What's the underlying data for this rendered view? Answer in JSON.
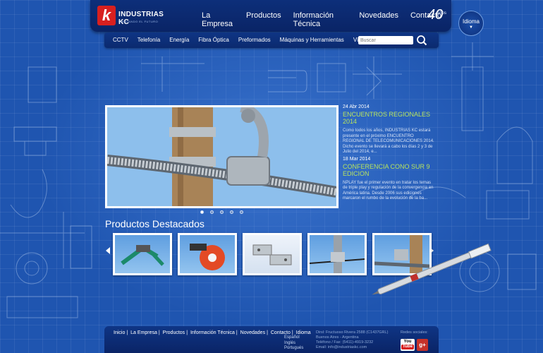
{
  "brand": {
    "mark": "k",
    "name": "INDUSTRIAS KC",
    "tagline": "DIBUJANDO EL FUTURO"
  },
  "main_nav": [
    {
      "label": "La Empresa"
    },
    {
      "label": "Productos"
    },
    {
      "label": "Información Técnica"
    },
    {
      "label": "Novedades"
    },
    {
      "label": "Contacto"
    }
  ],
  "anniversary": {
    "number": "40",
    "label": "años"
  },
  "language": {
    "label": "Idioma"
  },
  "sub_nav": [
    {
      "label": "CCTV"
    },
    {
      "label": "Telefonía"
    },
    {
      "label": "Energía"
    },
    {
      "label": "Fibra Óptica"
    },
    {
      "label": "Preformados"
    },
    {
      "label": "Máquinas y Herramientas"
    },
    {
      "label": "Vía Satélite"
    }
  ],
  "search": {
    "placeholder": "Buscar"
  },
  "slider": {
    "total": 5,
    "active_index": 0
  },
  "news": [
    {
      "date": "24 Abr 2014",
      "title": "ENCUENTROS REGIONALES 2014",
      "body": "Como todos los años, INDUSTRIAS KC estará presente en el próximo ENCUENTRO REGIONAL DE TELECOMUNICACIONES 2014. Dicho evento se llevará a cabo los días 2 y 3 de Julio del 2014, e..."
    },
    {
      "date": "18 Mar 2014",
      "title": "CONFERENCIA CONO SUR 9 EDICION",
      "body": "NPLAY fue el primer evento en tratar los temas de triple play y regulación de la convergencia en América latina. Desde 2006 sus ediciones marcaron el rumbo de la evolución de la ba..."
    }
  ],
  "products": {
    "title": "Productos Destacados",
    "items": [
      {
        "icon": "tensioning-tool-icon"
      },
      {
        "icon": "cable-reel-icon"
      },
      {
        "icon": "bracket-plates-icon"
      },
      {
        "icon": "pole-clamp-icon"
      },
      {
        "icon": "suspension-clamp-icon"
      }
    ]
  },
  "footer": {
    "links": [
      "Inicio",
      "La Empresa",
      "Productos",
      "Información Técnica",
      "Novedades",
      "Contacto",
      "Idioma"
    ],
    "languages": [
      "Español",
      "Inglés",
      "Portugués"
    ],
    "address": [
      "Dirsl: Fructuoso Rivera 2588 (C1437GRL)",
      "Buenos Aires - Argentina",
      "Teléfono / Fax: (5411)-4919-3232",
      "Email: info@industriaskc.com"
    ],
    "social_label": "Redes sociales:",
    "youtube_top": "You",
    "youtube_bottom": "Tube",
    "google_plus": "g+"
  },
  "colors": {
    "accent_green": "#b7e35f",
    "brand_red": "#d8201f",
    "bg_blue": "#1f55b0"
  }
}
